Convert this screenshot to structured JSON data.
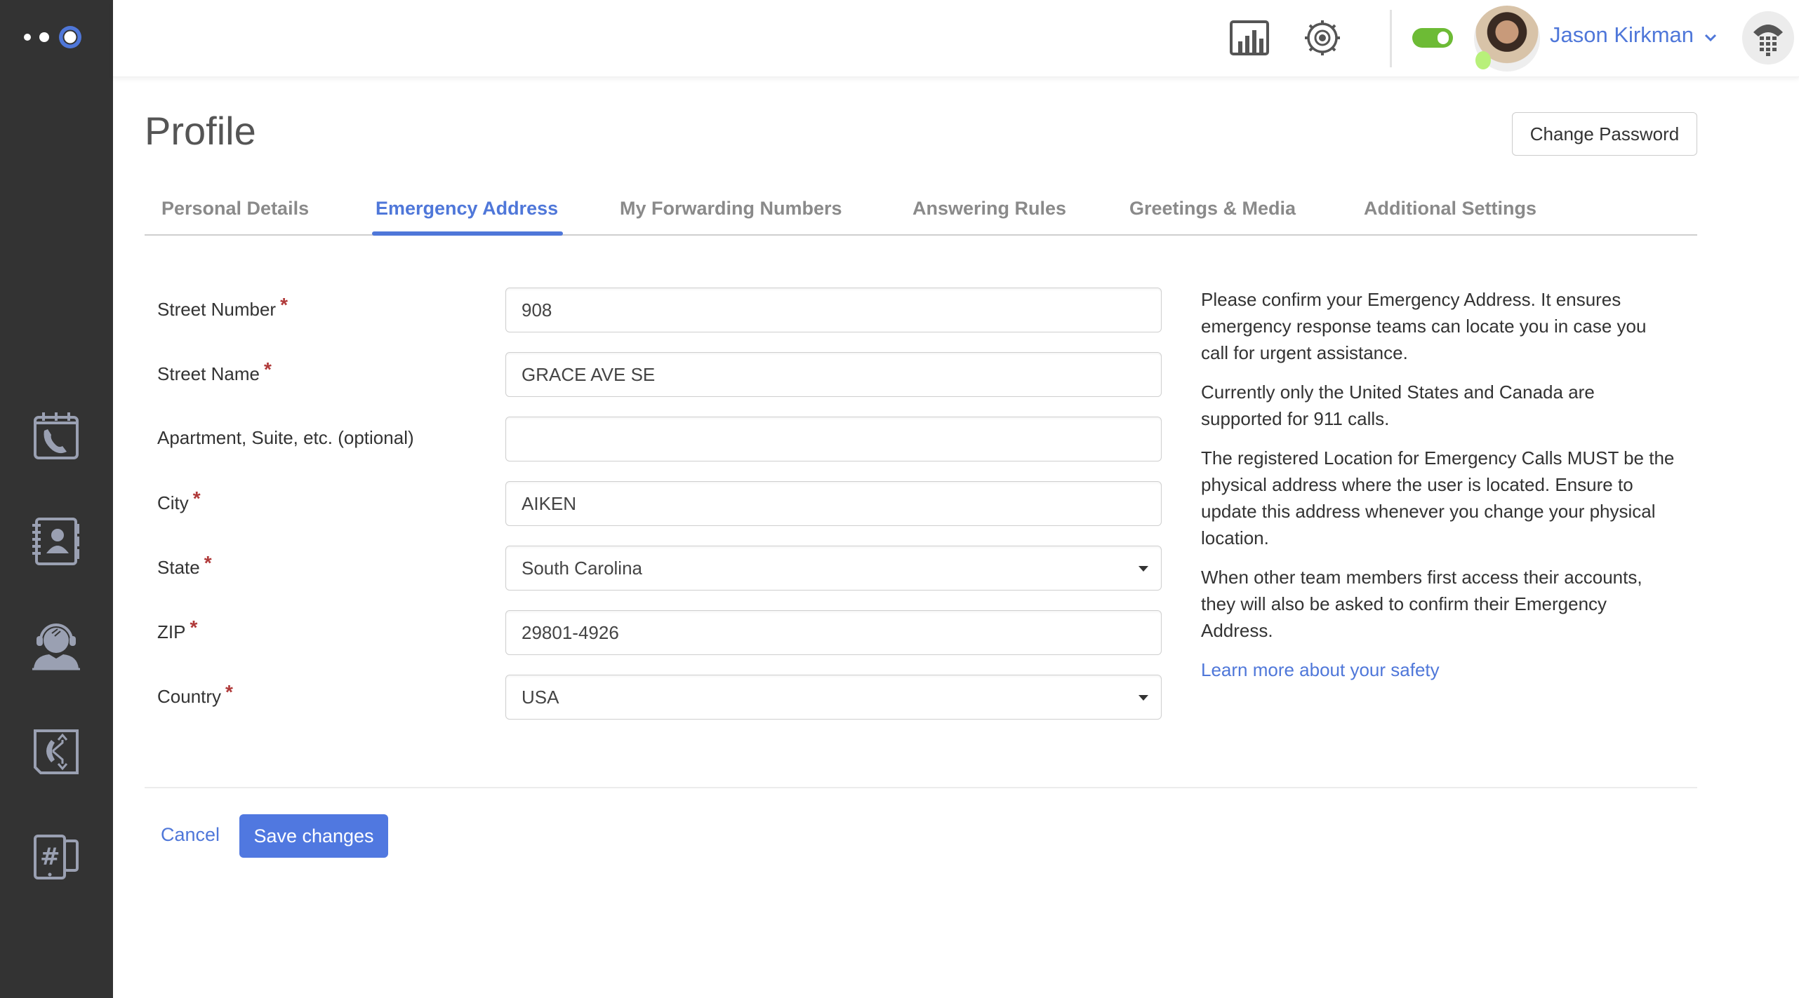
{
  "colors": {
    "accent": "#4f77d9",
    "sidebar_bg": "#333333",
    "status_green": "#6dbb35",
    "required": "#b03a3a"
  },
  "sidebar": {
    "logo": "brand-logo",
    "items": [
      {
        "icon": "call-history-icon"
      },
      {
        "icon": "contacts-icon"
      },
      {
        "icon": "call-center-agent-icon"
      },
      {
        "icon": "call-routing-icon"
      },
      {
        "icon": "phone-numbers-icon"
      }
    ]
  },
  "header": {
    "icons": [
      "analytics-icon",
      "settings-icon"
    ],
    "status_toggle": "on",
    "user_name": "Jason Kirkman",
    "dialpad_icon": "phone-dialpad-icon"
  },
  "page": {
    "title": "Profile",
    "change_password_label": "Change Password"
  },
  "tabs": [
    {
      "label": "Personal Details",
      "active": false
    },
    {
      "label": "Emergency Address",
      "active": true
    },
    {
      "label": "My Forwarding Numbers",
      "active": false
    },
    {
      "label": "Answering Rules",
      "active": false
    },
    {
      "label": "Greetings & Media",
      "active": false
    },
    {
      "label": "Additional Settings",
      "active": false
    }
  ],
  "form": {
    "required_mark": "*",
    "fields": [
      {
        "label": "Street Number",
        "required": true,
        "value": "908",
        "type": "text"
      },
      {
        "label": "Street Name",
        "required": true,
        "value": "GRACE AVE SE",
        "type": "text"
      },
      {
        "label": "Apartment, Suite, etc. (optional)",
        "required": false,
        "value": "",
        "type": "text"
      },
      {
        "label": "City",
        "required": true,
        "value": "AIKEN",
        "type": "text"
      },
      {
        "label": "State",
        "required": true,
        "value": "South Carolina",
        "type": "select"
      },
      {
        "label": "ZIP",
        "required": true,
        "value": "29801-4926",
        "type": "text"
      },
      {
        "label": "Country",
        "required": true,
        "value": "USA",
        "type": "select"
      }
    ]
  },
  "info": {
    "paragraphs": [
      "Please confirm your Emergency Address. It ensures emergency response teams can locate you in case you call for urgent assistance.",
      "Currently only the United States and Canada are supported for 911 calls.",
      "The registered Location for Emergency Calls MUST be the physical address where the user is located. Ensure to update this address whenever you change your physical location.",
      "When other team members first access their accounts, they will also be asked to confirm their Emergency Address."
    ],
    "link": "Learn more about your safety"
  },
  "actions": {
    "cancel_label": "Cancel",
    "save_label": "Save changes"
  }
}
